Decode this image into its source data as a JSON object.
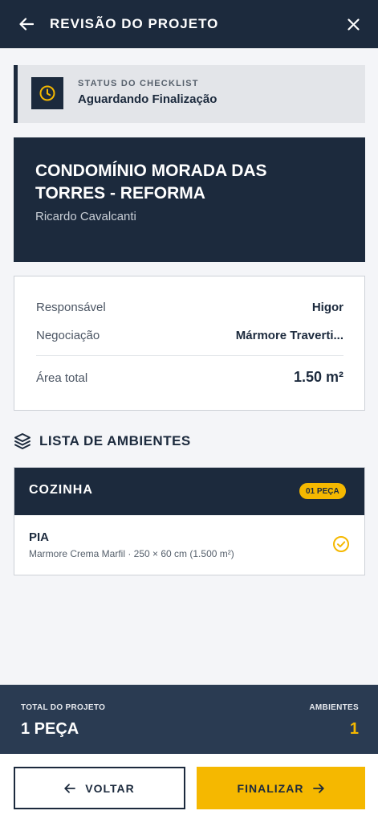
{
  "header": {
    "title": "REVISÃO DO PROJETO",
    "back_icon": "arrow-left-icon",
    "close_icon": "close-icon"
  },
  "status": {
    "label": "STATUS DO CHECKLIST",
    "value": "Aguardando Finalização",
    "icon": "clock-icon"
  },
  "project": {
    "name": "CONDOMÍNIO MORADA DAS TORRES - REFORMA",
    "client": "Ricardo Cavalcanti"
  },
  "details": {
    "responsavel_label": "Responsável",
    "responsavel_value": "Higor",
    "negociacao_label": "Negociação",
    "negociacao_value": "Mármore Traverti...",
    "area_label": "Área total",
    "area_value": "1.50 m²"
  },
  "section": {
    "title": "LISTA DE AMBIENTES",
    "icon": "layers-icon"
  },
  "rooms": [
    {
      "name": "COZINHA",
      "badge": "01 PEÇA",
      "pieces": [
        {
          "name": "PIA",
          "description": "Marmore Crema Marfil · 250 × 60 cm (1.500 m²)",
          "checked": true
        }
      ]
    }
  ],
  "summary": {
    "total_label": "TOTAL DO PROJETO",
    "total_value": "1 PEÇA",
    "rooms_label": "AMBIENTES",
    "rooms_value": "1"
  },
  "footer": {
    "back_label": "VOLTAR",
    "finish_label": "FINALIZAR"
  },
  "colors": {
    "navy": "#1c2a3d",
    "accent": "#f5b800",
    "summary_bg": "#2a3b52",
    "background": "#f4f5f8"
  }
}
